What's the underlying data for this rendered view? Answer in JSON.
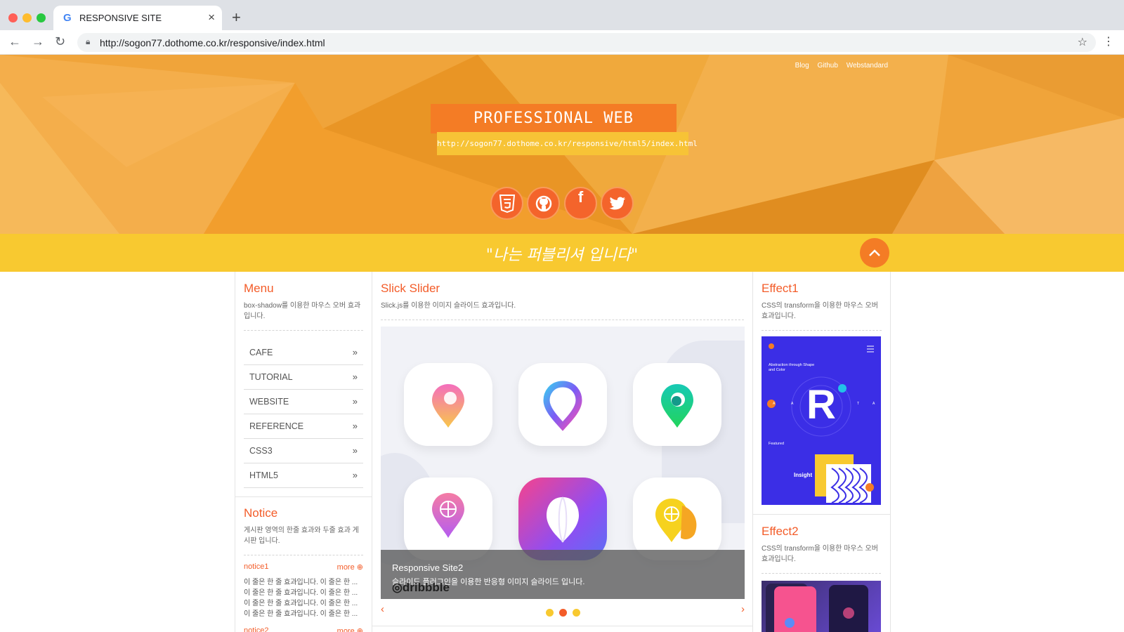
{
  "browser": {
    "tab_title": "RESPONSIVE SITE",
    "url": "http://sogon77.dothome.co.kr/responsive/index.html"
  },
  "header": {
    "links": [
      "Blog",
      "Github",
      "Webstandard"
    ],
    "title": "PROFESSIONAL WEB PUBLISHER",
    "site_url": "http://sogon77.dothome.co.kr/responsive/html5/index.html",
    "socials": [
      "html5-icon",
      "github-icon",
      "facebook-icon",
      "twitter-icon"
    ],
    "slogan": "\"나는 퍼블리셔 입니다\""
  },
  "menu": {
    "title": "Menu",
    "desc": "box-shadow를 이용한 마우스 오버 효과입니다.",
    "items": [
      "CAFE",
      "TUTORIAL",
      "WEBSITE",
      "REFERENCE",
      "CSS3",
      "HTML5"
    ]
  },
  "notice": {
    "title": "Notice",
    "desc": "게시판 영역의 한줄 효과와 두줄 효과 게시판 입니다.",
    "item1": "notice1",
    "item2": "notice2",
    "more": "more",
    "lines": [
      "이 줄은 한 줄 효과입니다. 이 줄은 한 ...",
      "이 줄은 한 줄 효과입니다. 이 줄은 한 ...",
      "이 줄은 한 줄 효과입니다. 이 줄은 한 ...",
      "이 줄은 한 줄 효과입니다. 이 줄은 한 ..."
    ]
  },
  "slider": {
    "title": "Slick Slider",
    "desc": "Slick.js를 이용한 이미지 슬라이드 효과입니다.",
    "caption_title": "Responsive Site2",
    "caption_desc": "슬라이드 플러그인을 이용한 반응형 이미지 슬라이드 입니다.",
    "watermark": "dribbble",
    "dots": 3,
    "active_dot": 2
  },
  "effect1": {
    "title": "Effect1",
    "desc": "CSS의 transform을 이용한 마우스 오버 효과입니다.",
    "poster_heading": "Abstraction through Shape and Color",
    "poster_letter": "R",
    "poster_featured": "Featured",
    "poster_insight": "Insight"
  },
  "effect2": {
    "title": "Effect2",
    "desc": "CSS의 transform을 이용한 마우스 오버 효과입니다."
  },
  "colors": {
    "accent": "#f35c29",
    "yellow": "#f8c930",
    "orange": "#f47c25"
  }
}
